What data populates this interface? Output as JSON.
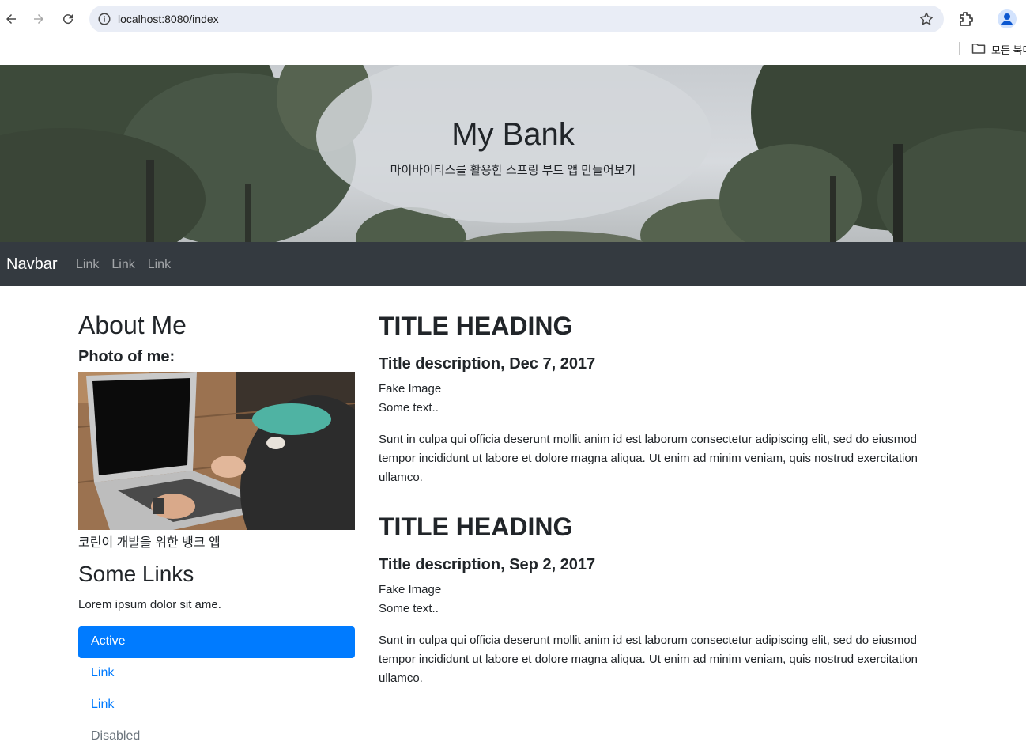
{
  "browser": {
    "url": "localhost:8080/index",
    "bookmarks_label": "모든 북마크"
  },
  "hero": {
    "title": "My Bank",
    "subtitle": "마이바이티스를 활용한 스프링 부트 앱 만들어보기"
  },
  "navbar": {
    "brand": "Navbar",
    "links": [
      "Link",
      "Link",
      "Link"
    ]
  },
  "sidebar": {
    "about_heading": "About Me",
    "photo_heading": "Photo of me:",
    "photo_caption": "코린이 개발을 위한 뱅크 앱",
    "links_heading": "Some Links",
    "links_text": "Lorem ipsum dolor sit ame.",
    "nav_items": [
      {
        "label": "Active",
        "state": "active"
      },
      {
        "label": "Link",
        "state": "link"
      },
      {
        "label": "Link",
        "state": "link"
      },
      {
        "label": "Disabled",
        "state": "disabled"
      }
    ]
  },
  "posts": [
    {
      "title": "TITLE HEADING",
      "description": "Title description, Dec 7, 2017",
      "image_text": "Fake Image",
      "some_text": "Some text..",
      "body": "Sunt in culpa qui officia deserunt mollit anim id est laborum consectetur adipiscing elit, sed do eiusmod tempor incididunt ut labore et dolore magna aliqua. Ut enim ad minim veniam, quis nostrud exercitation ullamco."
    },
    {
      "title": "TITLE HEADING",
      "description": "Title description, Sep 2, 2017",
      "image_text": "Fake Image",
      "some_text": "Some text..",
      "body": "Sunt in culpa qui officia deserunt mollit anim id est laborum consectetur adipiscing elit, sed do eiusmod tempor incididunt ut labore et dolore magna aliqua. Ut enim ad minim veniam, quis nostrud exercitation ullamco."
    }
  ],
  "colors": {
    "navbar_bg": "#343a40",
    "primary": "#007bff",
    "muted": "#6c757d",
    "text": "#212529"
  }
}
